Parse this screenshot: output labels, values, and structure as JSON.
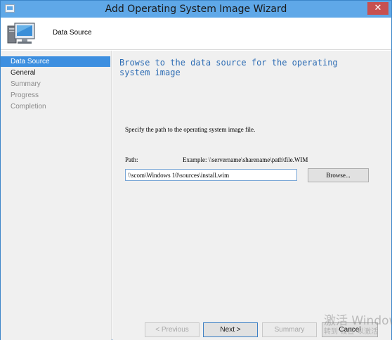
{
  "window": {
    "title": "Add Operating System Image Wizard",
    "close_glyph": "✕"
  },
  "header": {
    "step_title": "Data Source",
    "icon": "computer-monitor-icon"
  },
  "sidebar": {
    "items": [
      {
        "label": "Data Source",
        "state": "selected"
      },
      {
        "label": "General",
        "state": "current"
      },
      {
        "label": "Summary",
        "state": "pending"
      },
      {
        "label": "Progress",
        "state": "pending"
      },
      {
        "label": "Completion",
        "state": "pending"
      }
    ]
  },
  "main": {
    "heading": "Browse to the data source for the operating system image",
    "instruction": "Specify the path to the operating system image file.",
    "path_label": "Path:",
    "example": "Example: \\\\servername\\sharename\\path\\file.WIM",
    "path_value": "\\\\scom\\Windows 10\\sources\\install.wim",
    "browse_label": "Browse..."
  },
  "footer": {
    "previous_label": "< Previous",
    "next_label": "Next >",
    "summary_label": "Summary",
    "cancel_label": "Cancel"
  },
  "watermark": {
    "text": "激活 Windows",
    "sub": "转到\"设置\"以激活"
  },
  "colors": {
    "titlebar": "#5fa8e8",
    "selected": "#3d8fe0",
    "heading": "#2e6db4",
    "close": "#c75050"
  }
}
